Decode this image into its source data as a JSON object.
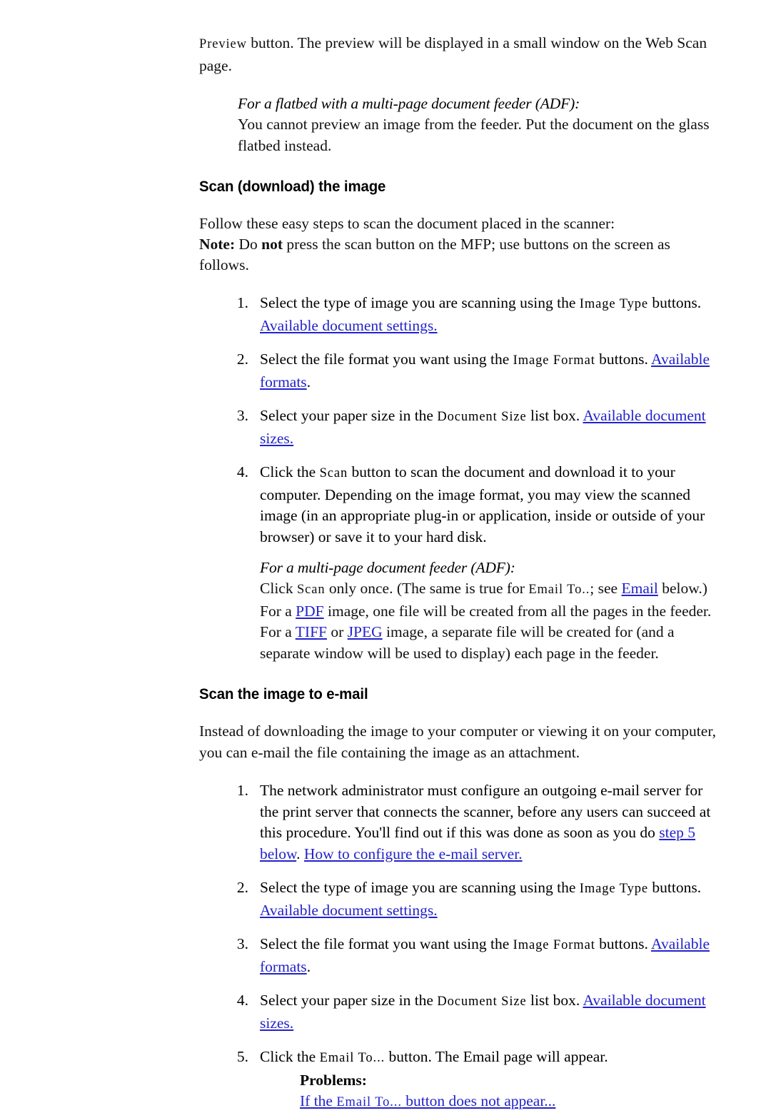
{
  "document": {
    "type": "scanned-manual-page",
    "link_color": "#2222cc",
    "text_color": "#111111",
    "background": "#ffffff"
  },
  "intro": {
    "ui_preview": "Preview",
    "text_after": " button. The preview will be displayed in a small window on the Web Scan page."
  },
  "adf_flatbed_note": {
    "heading": "For a flatbed with a multi-page document feeder (ADF):",
    "body": "You cannot preview an image from the feeder. Put the document on the glass flatbed instead."
  },
  "section_scan_download": {
    "heading": "Scan (download) the image",
    "intro_line": "Follow these easy steps to scan the document placed in the scanner:",
    "note_label": "Note:",
    "note_pre": " Do ",
    "note_bold": "not",
    "note_post": " press the scan button on the MFP; use buttons on the screen as follows.",
    "steps": [
      {
        "num": "1.",
        "pre": "Select the type of image you are scanning using the ",
        "ui": "Image Type",
        "mid": " buttons. ",
        "link": "Available document settings."
      },
      {
        "num": "2.",
        "pre": "Select the file format you want using the ",
        "ui": "Image Format",
        "mid": " buttons. ",
        "link": "Available formats",
        "post": "."
      },
      {
        "num": "3.",
        "pre": "Select your paper size in the ",
        "ui": "Document Size",
        "mid": " list box. ",
        "link": "Available document sizes."
      },
      {
        "num": "4.",
        "pre": "Click the ",
        "ui": "Scan",
        "mid": " button to scan the document and download it to your computer. Depending on the image format, you may view the scanned image (in an appropriate plug-in or application, inside or outside of your browser) or save it to your hard disk."
      }
    ],
    "adf_multipage": {
      "heading": "For a multi-page document feeder (ADF):",
      "p1_pre": "Click ",
      "p1_ui_scan": "Scan",
      "p1_mid": " only once. (The same is true for ",
      "p1_ui_email": "Email To..",
      "p1_mid2": "; see ",
      "p1_link_email": "Email",
      "p1_mid3": " below.) For a ",
      "p1_link_pdf": "PDF",
      "p1_mid4": " image, one file will be created from all the pages in the feeder. For a ",
      "p1_link_tiff": "TIFF",
      "p1_mid5": " or ",
      "p1_link_jpeg": "JPEG",
      "p1_end": " image, a separate file will be created for (and a separate window will be used to display) each page in the feeder."
    }
  },
  "section_scan_email": {
    "heading": "Scan the image to e-mail",
    "intro": "Instead of downloading the image to your computer or viewing it on your computer, you can e-mail the file containing the image as an attachment.",
    "steps": [
      {
        "num": "1.",
        "pre": "The network administrator must configure an outgoing e-mail server for the print server that connects the scanner, before any users can succeed at this procedure. You'll find out if this was done as soon as you do ",
        "link1": "step 5 below",
        "mid": ". ",
        "link2": "How to configure the e-mail server."
      },
      {
        "num": "2.",
        "pre": "Select the type of image you are scanning using the ",
        "ui": "Image Type",
        "mid": " buttons. ",
        "link": "Available document settings."
      },
      {
        "num": "3.",
        "pre": "Select the file format you want using the ",
        "ui": "Image Format",
        "mid": " buttons. ",
        "link": "Available formats",
        "post": "."
      },
      {
        "num": "4.",
        "pre": "Select your paper size in the ",
        "ui": "Document Size",
        "mid": " list box. ",
        "link": "Available document sizes."
      },
      {
        "num": "5.",
        "pre": "Click the ",
        "ui": "Email To...",
        "mid": " button. The Email page will appear.",
        "problems": {
          "title": "Problems:",
          "link_pre": "If the ",
          "link_ui": "Email To...",
          "link_post": " button does not appear..."
        }
      }
    ]
  }
}
